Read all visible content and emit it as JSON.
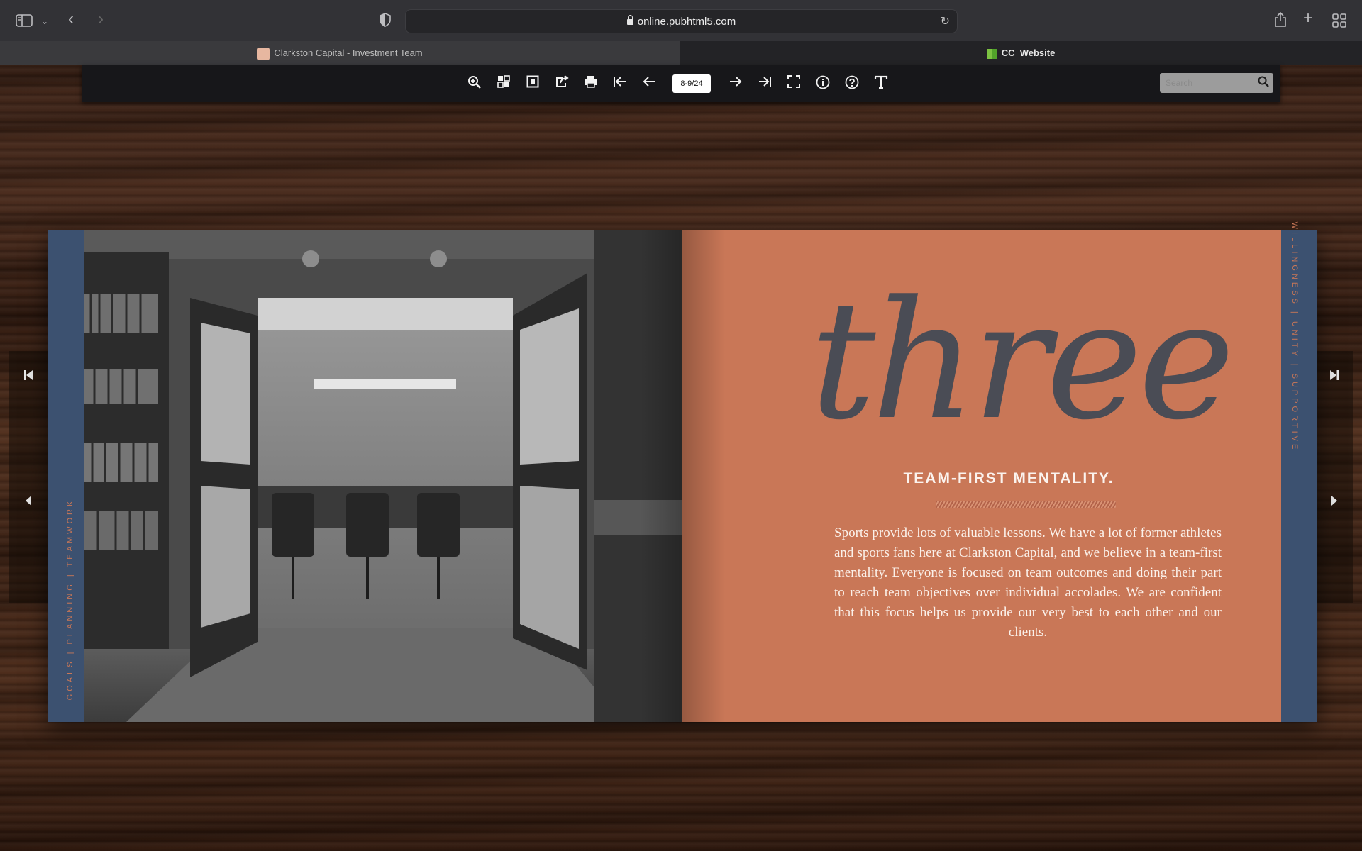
{
  "browser": {
    "url": "online.pubhtml5.com",
    "tabs": [
      {
        "label": "Clarkston Capital - Investment Team",
        "active": false
      },
      {
        "label": "CC_Website",
        "active": true
      }
    ]
  },
  "flipbook_toolbar": {
    "page_indicator": "8-9/24",
    "search_placeholder": "Search"
  },
  "book": {
    "left_page": {
      "vertical_text": "GOALS   |   PLANNING   |   TEAMWORK",
      "image": "conference-room-photo"
    },
    "right_page": {
      "heading": "three",
      "subtitle": "TEAM-FIRST MENTALITY.",
      "body": "Sports provide lots of valuable lessons. We have a lot of former athletes and sports fans here at Clarkston Capital, and we believe in a team-first mentality. Everyone is focused on team outcomes and doing their part to reach team objectives over individual accolades. We are confident that this focus helps us provide our very best to each other and our clients.",
      "vertical_text": "WILLINGNESS   |   UNITY   |   SUPPORTIVE"
    }
  },
  "colors": {
    "accent_orange": "#c97757",
    "band_blue": "#3c5170",
    "heading_gray": "#4a4c55"
  }
}
